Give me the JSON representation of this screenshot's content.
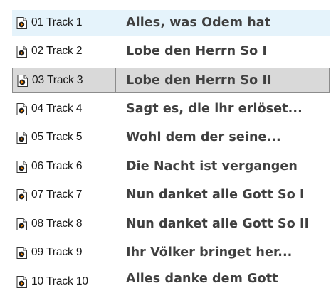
{
  "tracks": [
    {
      "file": "01 Track 1",
      "title": "Alles, was Odem hat",
      "state": "hover"
    },
    {
      "file": "02 Track 2",
      "title": "Lobe den Herrn So I",
      "state": "normal"
    },
    {
      "file": "03 Track 3",
      "title": "Lobe den Herrn  So II",
      "state": "selected"
    },
    {
      "file": "04 Track 4",
      "title": "Sagt es, die ihr erlöset...",
      "state": "normal"
    },
    {
      "file": "05 Track 5",
      "title": "Wohl dem der seine...",
      "state": "normal"
    },
    {
      "file": "06 Track 6",
      "title": "Die Nacht ist vergangen",
      "state": "normal"
    },
    {
      "file": "07 Track 7",
      "title": "Nun danket alle Gott So I",
      "state": "normal"
    },
    {
      "file": "08 Track 8",
      "title": "Nun danket alle Gott So II",
      "state": "normal"
    },
    {
      "file": "09 Track 9",
      "title": "Ihr Völker bringet her...",
      "state": "normal"
    },
    {
      "file": "10 Track 10",
      "title": "Alles danke dem Gott",
      "state": "normal"
    }
  ],
  "icon": "media-file-icon",
  "colors": {
    "hover_bg": "#e5f3fb",
    "selected_bg": "#d9d9d9",
    "selected_border": "#8c8c8c",
    "title_text": "#404040",
    "label_text": "#1a1a1a"
  }
}
